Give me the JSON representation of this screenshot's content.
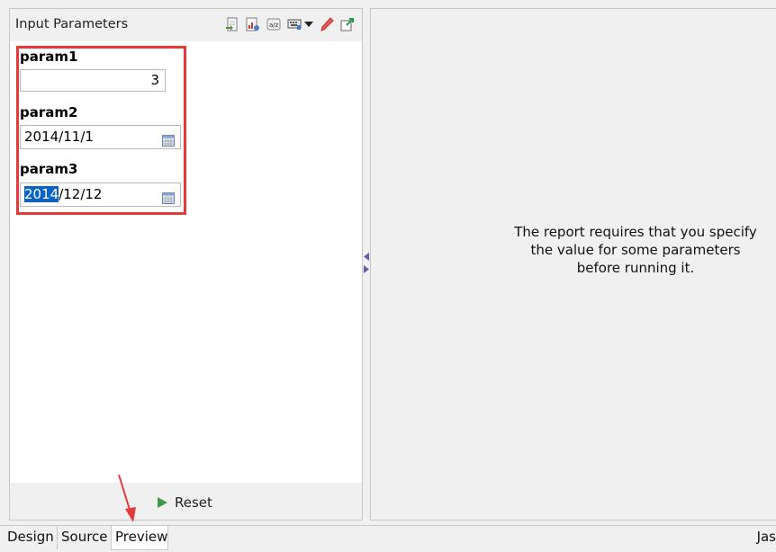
{
  "panel": {
    "title": "Input Parameters",
    "toolbar_icons": [
      "import-icon",
      "chart-icon",
      "sort-az-icon",
      "keyboard-icon",
      "dropdown-icon",
      "eraser-icon",
      "export-icon"
    ]
  },
  "params": [
    {
      "label": "param1",
      "value": "3",
      "type": "number"
    },
    {
      "label": "param2",
      "value": "2014/11/1",
      "type": "date"
    },
    {
      "label": "param3",
      "value_selected": "2014",
      "value_rest": "/12/12",
      "type": "date"
    }
  ],
  "reset_label": "Reset",
  "message": [
    "The report requires that you specify",
    "the value for some parameters",
    "before running it."
  ],
  "tabs": [
    "Design",
    "Source",
    "Preview"
  ],
  "active_tab": "Preview",
  "status_right": "Jas",
  "colors": {
    "highlight_box": "#e8393a",
    "selection": "#0a64c8",
    "annotation_arrow": "#e8393a"
  }
}
